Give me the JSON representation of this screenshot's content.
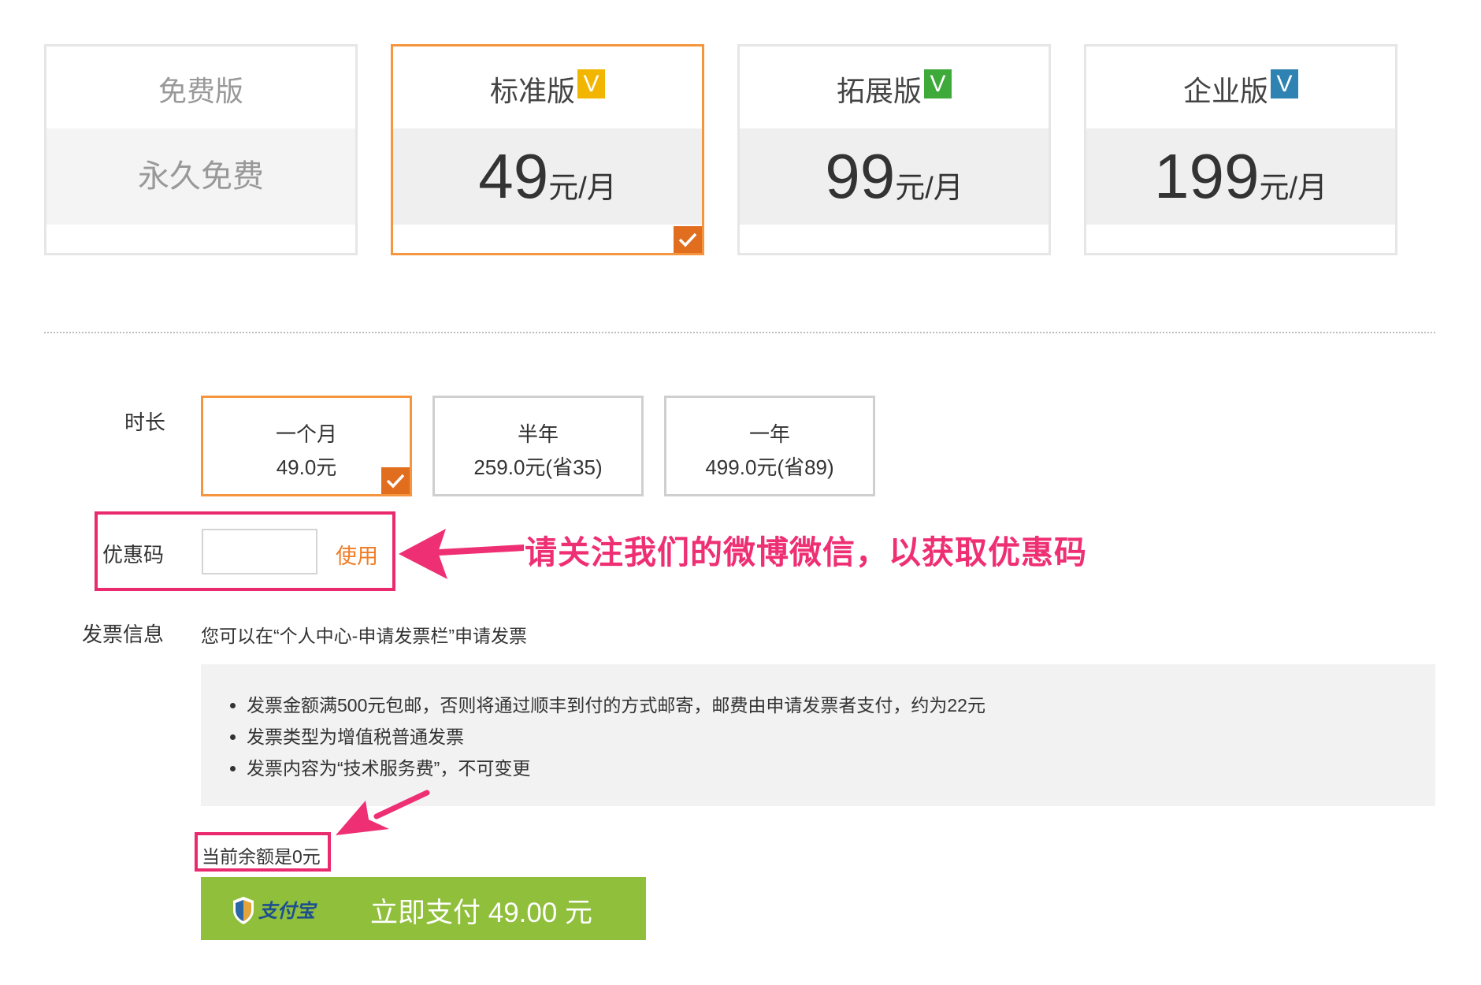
{
  "plans": [
    {
      "name": "免费版",
      "price_text": "永久免费"
    },
    {
      "name": "标准版",
      "badge": "V",
      "badge_color": "#f3b600",
      "price": "49",
      "unit": "元/月"
    },
    {
      "name": "拓展版",
      "badge": "V",
      "badge_color": "#3eaa3a",
      "price": "99",
      "unit": "元/月"
    },
    {
      "name": "企业版",
      "badge": "V",
      "badge_color": "#2f83b2",
      "price": "199",
      "unit": "元/月"
    }
  ],
  "duration": {
    "label": "时长",
    "options": [
      {
        "name": "一个月",
        "price": "49.0元"
      },
      {
        "name": "半年",
        "price": "259.0元(省35)"
      },
      {
        "name": "一年",
        "price": "499.0元(省89)"
      }
    ]
  },
  "coupon": {
    "label": "优惠码",
    "value": "",
    "use_label": "使用"
  },
  "annotation": "请关注我们的微博微信，以获取优惠码",
  "invoice": {
    "label": "发票信息",
    "note": "您可以在“个人中心-申请发票栏”申请发票",
    "items": [
      "发票金额满500元包邮，否则将通过顺丰到付的方式邮寄，邮费由申请发票者支付，约为22元",
      "发票类型为增值税普通发票",
      "发票内容为“技术服务费”，不可变更"
    ]
  },
  "balance": "当前余额是0元",
  "pay": {
    "logo_text": "支付宝",
    "label": "立即支付 49.00 元"
  },
  "colors": {
    "accent": "#f5953d",
    "check": "#e16e1f",
    "highlight": "#ea2a6e",
    "pay": "#8fbf3b"
  }
}
